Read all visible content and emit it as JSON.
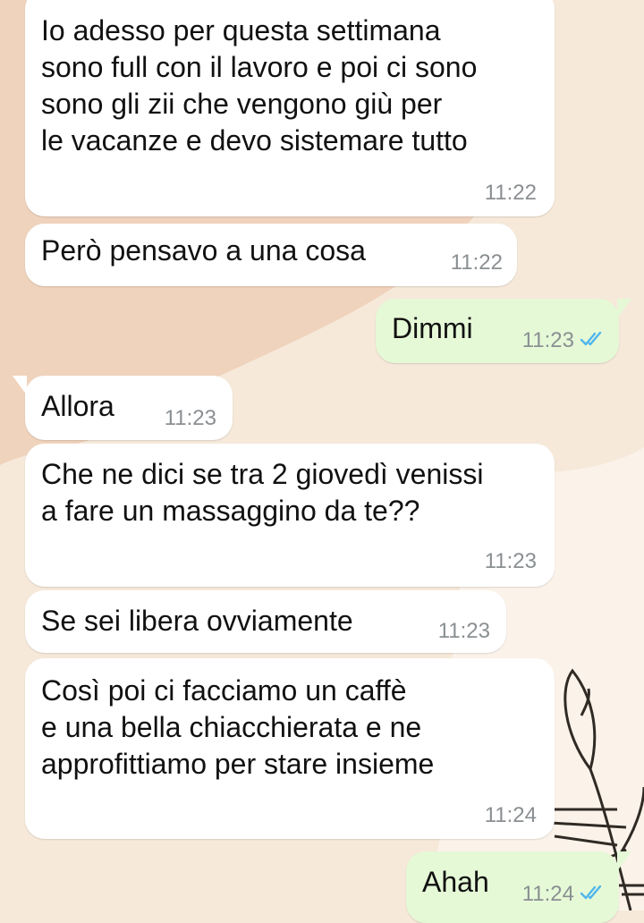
{
  "messages": [
    {
      "direction": "incoming",
      "lines": [
        "Io adesso per questa settimana",
        "sono full con il lavoro e poi ci sono",
        "sono gli zii che vengono giù per",
        "le vacanze e devo sistemare tutto"
      ],
      "time": "11:22"
    },
    {
      "direction": "incoming",
      "lines": [
        "Però pensavo a una cosa"
      ],
      "time": "11:22"
    },
    {
      "direction": "outgoing",
      "lines": [
        "Dimmi"
      ],
      "time": "11:23",
      "status": "read"
    },
    {
      "direction": "incoming",
      "lines": [
        "Allora"
      ],
      "time": "11:23"
    },
    {
      "direction": "incoming",
      "lines": [
        "Che ne dici se tra 2 giovedì venissi",
        "a fare un massaggino da te??"
      ],
      "time": "11:23"
    },
    {
      "direction": "incoming",
      "lines": [
        "Se sei libera ovviamente"
      ],
      "time": "11:23"
    },
    {
      "direction": "incoming",
      "lines": [
        "Così poi ci facciamo un caffè",
        "e una bella chiacchierata e ne",
        "approfittiamo per stare insieme"
      ],
      "time": "11:24"
    },
    {
      "direction": "outgoing",
      "lines": [
        "Ahah"
      ],
      "time": "11:24",
      "status": "read"
    }
  ],
  "colors": {
    "incoming_bubble": "#ffffff",
    "outgoing_bubble": "#e6f9d7",
    "timestamp": "#8a8f92",
    "read_ticks": "#4fb6ec",
    "wallpaper_base": "#f6e9da",
    "wallpaper_shape": "#efcfb6"
  },
  "icons": {
    "read_receipt": "double-check-icon",
    "wallpaper_art": "leaf-branch-icon"
  }
}
